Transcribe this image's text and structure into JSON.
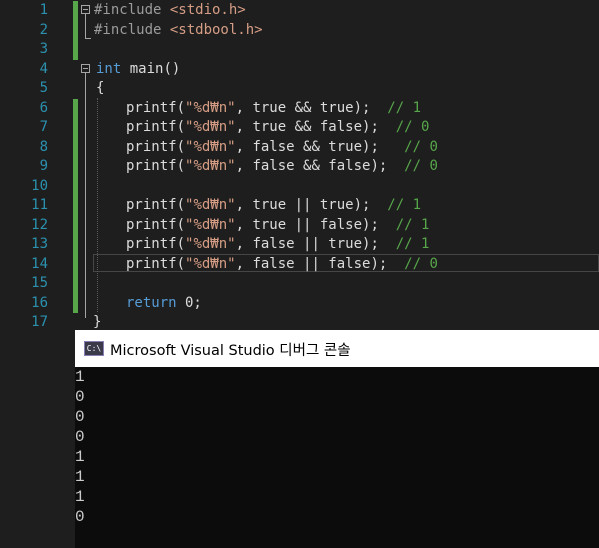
{
  "editor": {
    "line_numbers": [
      "1",
      "2",
      "3",
      "4",
      "5",
      "6",
      "7",
      "8",
      "9",
      "10",
      "11",
      "12",
      "13",
      "14",
      "15",
      "16",
      "17"
    ],
    "code": {
      "l1": {
        "kw": "#include ",
        "inc": "<stdio.h>"
      },
      "l2": {
        "kw": "#include ",
        "inc": "<stdbool.h>"
      },
      "l4": {
        "type": "int",
        "rest": " main()"
      },
      "l5": {
        "text": "{"
      },
      "l6": {
        "call": "printf(",
        "str": "\"%d₩n\"",
        "mid": ", true && true);",
        "cmt": "  // 1"
      },
      "l7": {
        "call": "printf(",
        "str": "\"%d₩n\"",
        "mid": ", true && false);",
        "cmt": "  // 0"
      },
      "l8": {
        "call": "printf(",
        "str": "\"%d₩n\"",
        "mid": ", false && true);",
        "cmt": "   // 0"
      },
      "l9": {
        "call": "printf(",
        "str": "\"%d₩n\"",
        "mid": ", false && false);",
        "cmt": "  // 0"
      },
      "l11": {
        "call": "printf(",
        "str": "\"%d₩n\"",
        "mid": ", true || true);",
        "cmt": "  // 1"
      },
      "l12": {
        "call": "printf(",
        "str": "\"%d₩n\"",
        "mid": ", true || false);",
        "cmt": "  // 1"
      },
      "l13": {
        "call": "printf(",
        "str": "\"%d₩n\"",
        "mid": ", false || true);",
        "cmt": "  // 1"
      },
      "l14": {
        "call": "printf(",
        "str": "\"%d₩n\"",
        "mid": ", false || false);",
        "cmt": "  // 0"
      },
      "l16": {
        "kw": "return",
        "rest": " 0;"
      },
      "l17": {
        "text": "}"
      }
    }
  },
  "console": {
    "title": "Microsoft Visual Studio 디버그 콘솔",
    "icon": "console-app-icon",
    "icon_glyph": "C:\\",
    "output": [
      "1",
      "0",
      "0",
      "0",
      "1",
      "1",
      "1",
      "0"
    ]
  },
  "colors": {
    "editor_bg": "#1e1e1e",
    "line_number": "#2b91af",
    "keyword": "#569cd6",
    "string": "#d69d85",
    "comment": "#57a64a",
    "change_bar": "#57a64a",
    "console_bg": "#0c0c0c"
  }
}
